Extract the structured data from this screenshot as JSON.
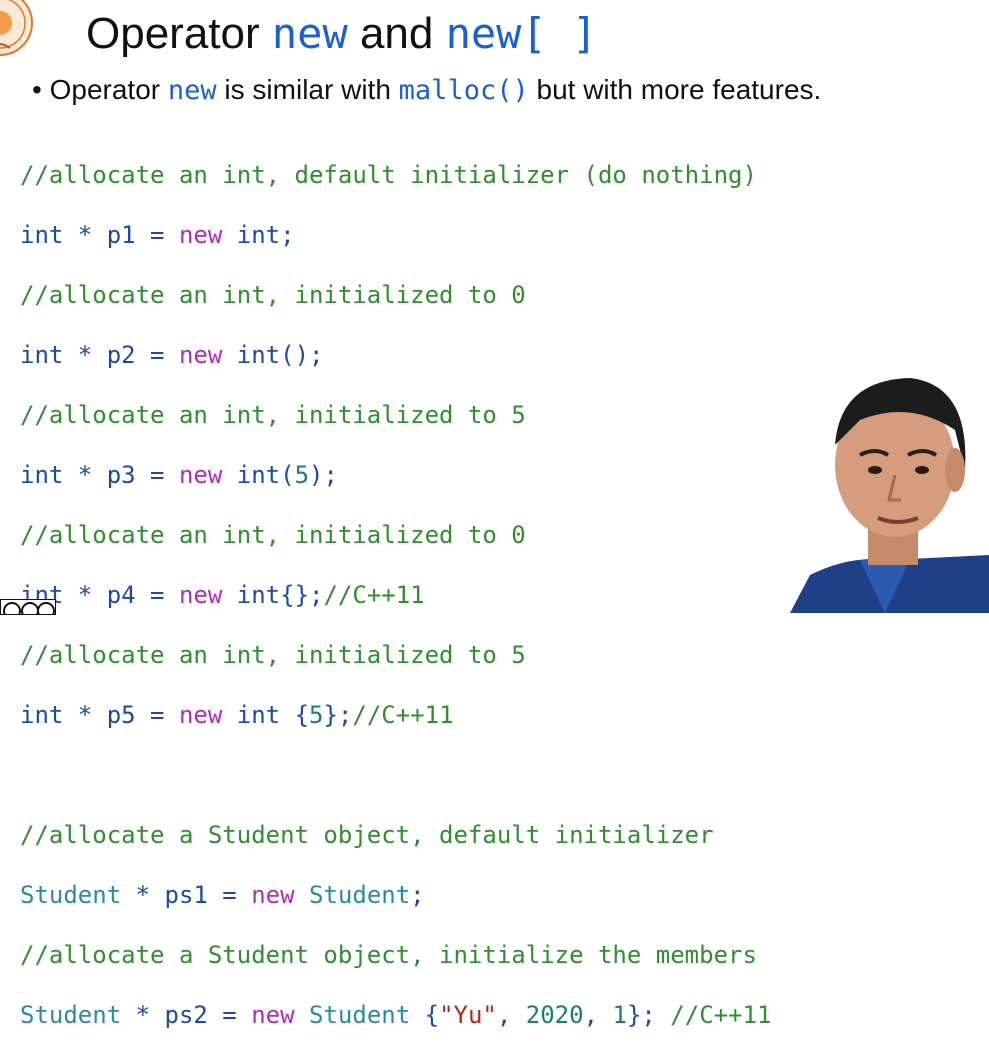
{
  "slide": {
    "title": {
      "part1": "Operator ",
      "kw1": "new",
      "part2": " and ",
      "kw2": "new[ ]"
    },
    "bullet": {
      "dot": "•",
      "part1": "Operator ",
      "kw1": "new",
      "part2": " is similar with ",
      "kw2": "malloc()",
      "part3": " but with more features."
    }
  },
  "code": {
    "l1": {
      "c": "//allocate an int, default initializer (do nothing)"
    },
    "l2": {
      "t": "int * p1 = ",
      "k": "new",
      "sp": " ",
      "ty": "int",
      "end": ";"
    },
    "l3": {
      "c": "//allocate an int, initialized to 0"
    },
    "l4": {
      "t": "int * p2 = ",
      "k": "new",
      "sp": " ",
      "ty": "int",
      "end": "();"
    },
    "l5": {
      "c": "//allocate an int, initialized to 5"
    },
    "l6": {
      "t": "int * p3 = ",
      "k": "new",
      "sp": " ",
      "ty": "int",
      "p1": "(",
      "n": "5",
      "end": ");"
    },
    "l7": {
      "c": "//allocate an int, initialized to 0"
    },
    "l8": {
      "t": "int * p4 = ",
      "k": "new",
      "sp": " ",
      "ty": "int",
      "end": "{};",
      "c": "//C++11"
    },
    "l9": {
      "c": "//allocate an int, initialized to 5"
    },
    "l10": {
      "t": "int * p5 = ",
      "k": "new",
      "sp": " ",
      "ty": "int",
      "p1": " {",
      "n": "5",
      "end": "};",
      "c": "//C++11"
    },
    "l11": {
      "c": ""
    },
    "l12": {
      "c": "//allocate a Student object, default initializer"
    },
    "l13": {
      "cls": "Student",
      "t": " * ps1 = ",
      "k": "new",
      "sp": " ",
      "cls2": "Student",
      "end": ";"
    },
    "l14": {
      "c": "//allocate a Student object, initialize the members"
    },
    "l15": {
      "cls": "Student",
      "t": " * ps2 = ",
      "k": "new",
      "sp": " ",
      "cls2": "Student",
      "p1": " {",
      "s": "\"Yu\"",
      "c1": ", ",
      "n1": "2020",
      "c2": ", ",
      "n2": "1",
      "end": "}; ",
      "c": "//C++11"
    }
  },
  "colors": {
    "keyword_blue": "#1a5fd6",
    "comment_green": "#2f8f2f",
    "new_purple": "#b22ac4",
    "class_teal": "#2a8ca0",
    "number_teal": "#19806e",
    "string_red": "#b5261e"
  },
  "icons": {
    "logo": "university-seal-icon",
    "license": "creative-commons-icon"
  }
}
